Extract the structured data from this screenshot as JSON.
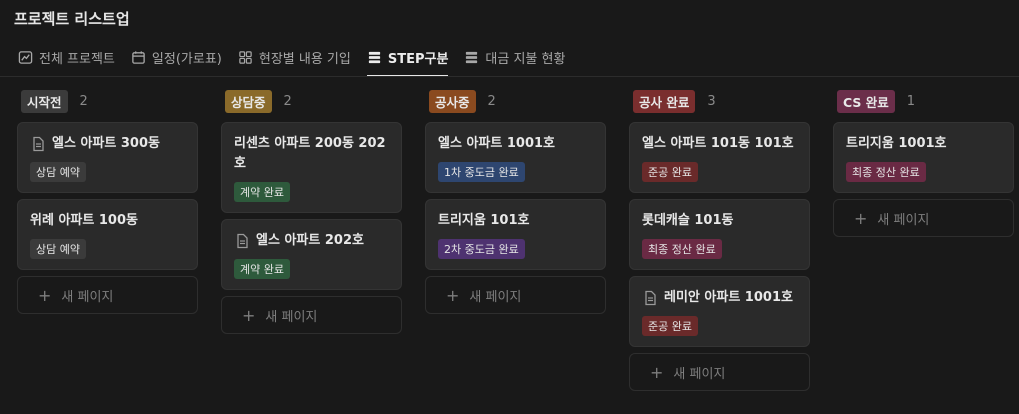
{
  "page_title": "프로젝트 리스트업",
  "tabs": [
    {
      "label": "전체 프로젝트",
      "icon": "chart-icon"
    },
    {
      "label": "일정(가로표)",
      "icon": "calendar-icon"
    },
    {
      "label": "현장별 내용 기입",
      "icon": "gallery-icon"
    },
    {
      "label": "STEP구분",
      "icon": "board-icon",
      "active": true
    },
    {
      "label": "대금 지불 현황",
      "icon": "table-icon"
    }
  ],
  "new_page_label": "새 페이지",
  "colors": {
    "status_not_started": "#3b3b3b",
    "status_consult": "#8a6a2a",
    "status_construction": "#8a4a1f",
    "status_construction_done": "#7a2e2e",
    "status_cs_done": "#6b2e4a",
    "tag_consult_reserve": "#3b3b3b",
    "tag_contract_done": "#2e5a3c",
    "tag_first_payment": "#2e4670",
    "tag_second_payment": "#4e3270",
    "tag_completion": "#6a2a2a",
    "tag_final_settle": "#6a2a44"
  },
  "columns": [
    {
      "label": "시작전",
      "count": "2",
      "cards": [
        {
          "title": "엘스 아파트 300동",
          "doc": true,
          "tag": "상담 예약"
        },
        {
          "title": "위례 아파트 100동",
          "doc": false,
          "tag": "상담 예약"
        }
      ]
    },
    {
      "label": "상담중",
      "count": "2",
      "cards": [
        {
          "title": "리센츠 아파트 200동 202호",
          "doc": false,
          "tag": "계약 완료"
        },
        {
          "title": "엘스 아파트 202호",
          "doc": true,
          "tag": "계약 완료"
        }
      ]
    },
    {
      "label": "공사중",
      "count": "2",
      "cards": [
        {
          "title": "엘스 아파트 1001호",
          "doc": false,
          "tag": "1차 중도금 완료"
        },
        {
          "title": "트리지움 101호",
          "doc": false,
          "tag": "2차 중도금 완료"
        }
      ]
    },
    {
      "label": "공사 완료",
      "count": "3",
      "cards": [
        {
          "title": "엘스 아파트 101동 101호",
          "doc": false,
          "tag": "준공 완료"
        },
        {
          "title": "롯데캐슬 101동",
          "doc": false,
          "tag": "최종 정산 완료"
        },
        {
          "title": "레미안 아파트 1001호",
          "doc": true,
          "tag": "준공 완료"
        }
      ]
    },
    {
      "label": "CS 완료",
      "count": "1",
      "cards": [
        {
          "title": "트리지움 1001호",
          "doc": false,
          "tag": "최종 정산 완료"
        }
      ]
    }
  ]
}
